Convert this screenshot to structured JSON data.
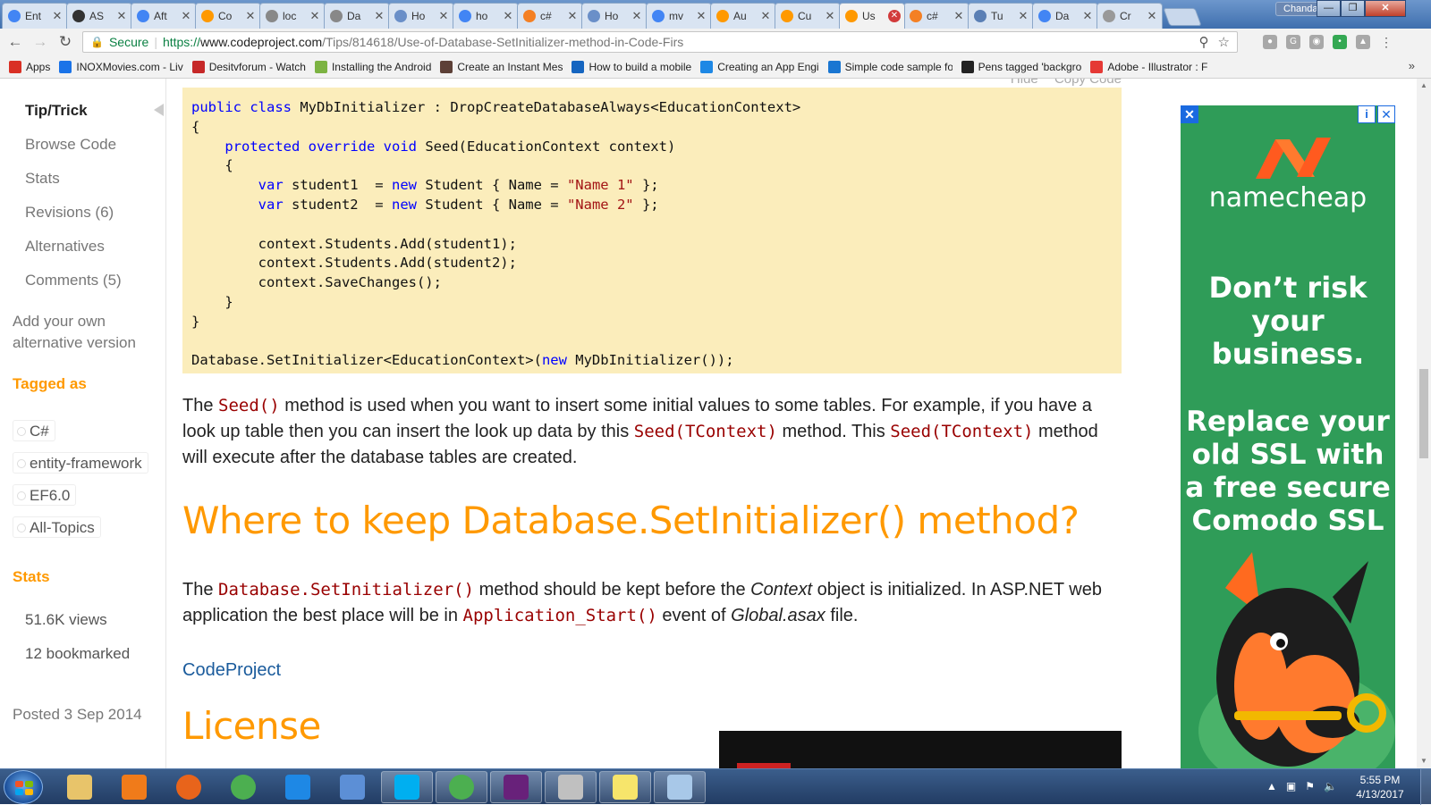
{
  "browser": {
    "profile_name": "Chandan",
    "tabs": [
      {
        "title": "Ent",
        "icon": "google-icon",
        "color": "#4285f4"
      },
      {
        "title": "AS",
        "icon": "asp-icon",
        "color": "#333333"
      },
      {
        "title": "Aft",
        "icon": "google-icon",
        "color": "#4285f4"
      },
      {
        "title": "Co",
        "icon": "codeproject-icon",
        "color": "#f90"
      },
      {
        "title": "loc",
        "icon": "document-icon",
        "color": "#888888"
      },
      {
        "title": "Da",
        "icon": "document-icon",
        "color": "#888888"
      },
      {
        "title": "Ho",
        "icon": "page-icon",
        "color": "#6a8fc8"
      },
      {
        "title": "ho",
        "icon": "google-icon",
        "color": "#4285f4"
      },
      {
        "title": "c#",
        "icon": "stackoverflow-icon",
        "color": "#f48024"
      },
      {
        "title": "Ho",
        "icon": "page-icon",
        "color": "#6a8fc8"
      },
      {
        "title": "mv",
        "icon": "google-icon",
        "color": "#4285f4"
      },
      {
        "title": "Au",
        "icon": "codeproject-icon",
        "color": "#f90"
      },
      {
        "title": "Cu",
        "icon": "codeproject-icon",
        "color": "#f90"
      },
      {
        "title": "Us",
        "icon": "codeproject-icon",
        "color": "#f90",
        "active": true
      },
      {
        "title": "c#",
        "icon": "stackoverflow-icon",
        "color": "#f48024"
      },
      {
        "title": "Tu",
        "icon": "tutorial-icon",
        "color": "#5a7fb5"
      },
      {
        "title": "Da",
        "icon": "google-icon",
        "color": "#4285f4"
      },
      {
        "title": "Cr",
        "icon": "generic-icon",
        "color": "#999999"
      }
    ],
    "address": {
      "secure_label": "Secure",
      "url_scheme": "https://",
      "url_host": "www.codeproject.com",
      "url_path": "/Tips/814618/Use-of-Database-SetInitializer-method-in-Code-Firs"
    },
    "bookmarks": [
      {
        "label": "Apps",
        "color": "#d93025"
      },
      {
        "label": "INOXMovies.com - Liv",
        "color": "#1a73e8"
      },
      {
        "label": "Desitvforum - Watch",
        "color": "#c62828"
      },
      {
        "label": "Installing the Android",
        "color": "#7cb342"
      },
      {
        "label": "Create an Instant Mes",
        "color": "#5d4037"
      },
      {
        "label": "How to build a mobile",
        "color": "#1565c0"
      },
      {
        "label": "Creating an App Engi",
        "color": "#1e88e5"
      },
      {
        "label": "Simple code sample fo",
        "color": "#1976d2"
      },
      {
        "label": "Pens tagged 'backgro",
        "color": "#222222"
      },
      {
        "label": "Adobe - Illustrator : F",
        "color": "#e53935"
      }
    ]
  },
  "sidebar": {
    "items": [
      {
        "label": "Tip/Trick",
        "active": true
      },
      {
        "label": "Browse Code"
      },
      {
        "label": "Stats"
      },
      {
        "label": "Revisions (6)"
      },
      {
        "label": "Alternatives"
      },
      {
        "label": "Comments (5)"
      }
    ],
    "add_own": "Add your own alternative version",
    "tagged_heading": "Tagged as",
    "tags": [
      "C#",
      "entity-framework",
      "EF6.0",
      "All-Topics"
    ],
    "stats_heading": "Stats",
    "stats": [
      "51.6K views",
      "12 bookmarked"
    ],
    "posted": "Posted 3 Sep 2014"
  },
  "article": {
    "code_links": {
      "hide": "Hide",
      "copy": "Copy Code"
    },
    "para1": {
      "t1": "The ",
      "c1": "Seed()",
      "t2": " method is used when you want to insert some initial values to some tables. For example, if you have a look up table then you can insert the look up data by this ",
      "c2": "Seed(TContext)",
      "t3": " method. This ",
      "c3": "Seed(TContext)",
      "t4": " method will execute after the database tables are created."
    },
    "heading": "Where to keep Database.SetInitializer() method?",
    "para2": {
      "t1": "The ",
      "c1": "Database.SetInitializer()",
      "t2": " method should be kept before the ",
      "i1": "Context",
      "t3": " object is initialized. In ASP.NET web application the best place will be in ",
      "c2": "Application_Start()",
      "t4": " event of ",
      "i2": "Global.asax",
      "t5": " file."
    },
    "link": "CodeProject",
    "license_heading": "License"
  },
  "ad": {
    "brand": "namecheap",
    "headline1": "Don’t risk your business.",
    "headline2": "Replace your old SSL with a free secure Comodo SSL",
    "colors": {
      "bg": "#2f9c58",
      "logo": "#ff5a1f"
    }
  },
  "taskbar": {
    "apps": [
      "explorer-icon",
      "media-player-icon",
      "firefox-icon",
      "chrome-icon",
      "ie-icon",
      "network-icon",
      "skype-icon",
      "chrome-icon",
      "visual-studio-icon",
      "paint-icon",
      "sticky-notes-icon",
      "notepad-icon"
    ],
    "time": "5:55 PM",
    "date": "4/13/2017"
  }
}
